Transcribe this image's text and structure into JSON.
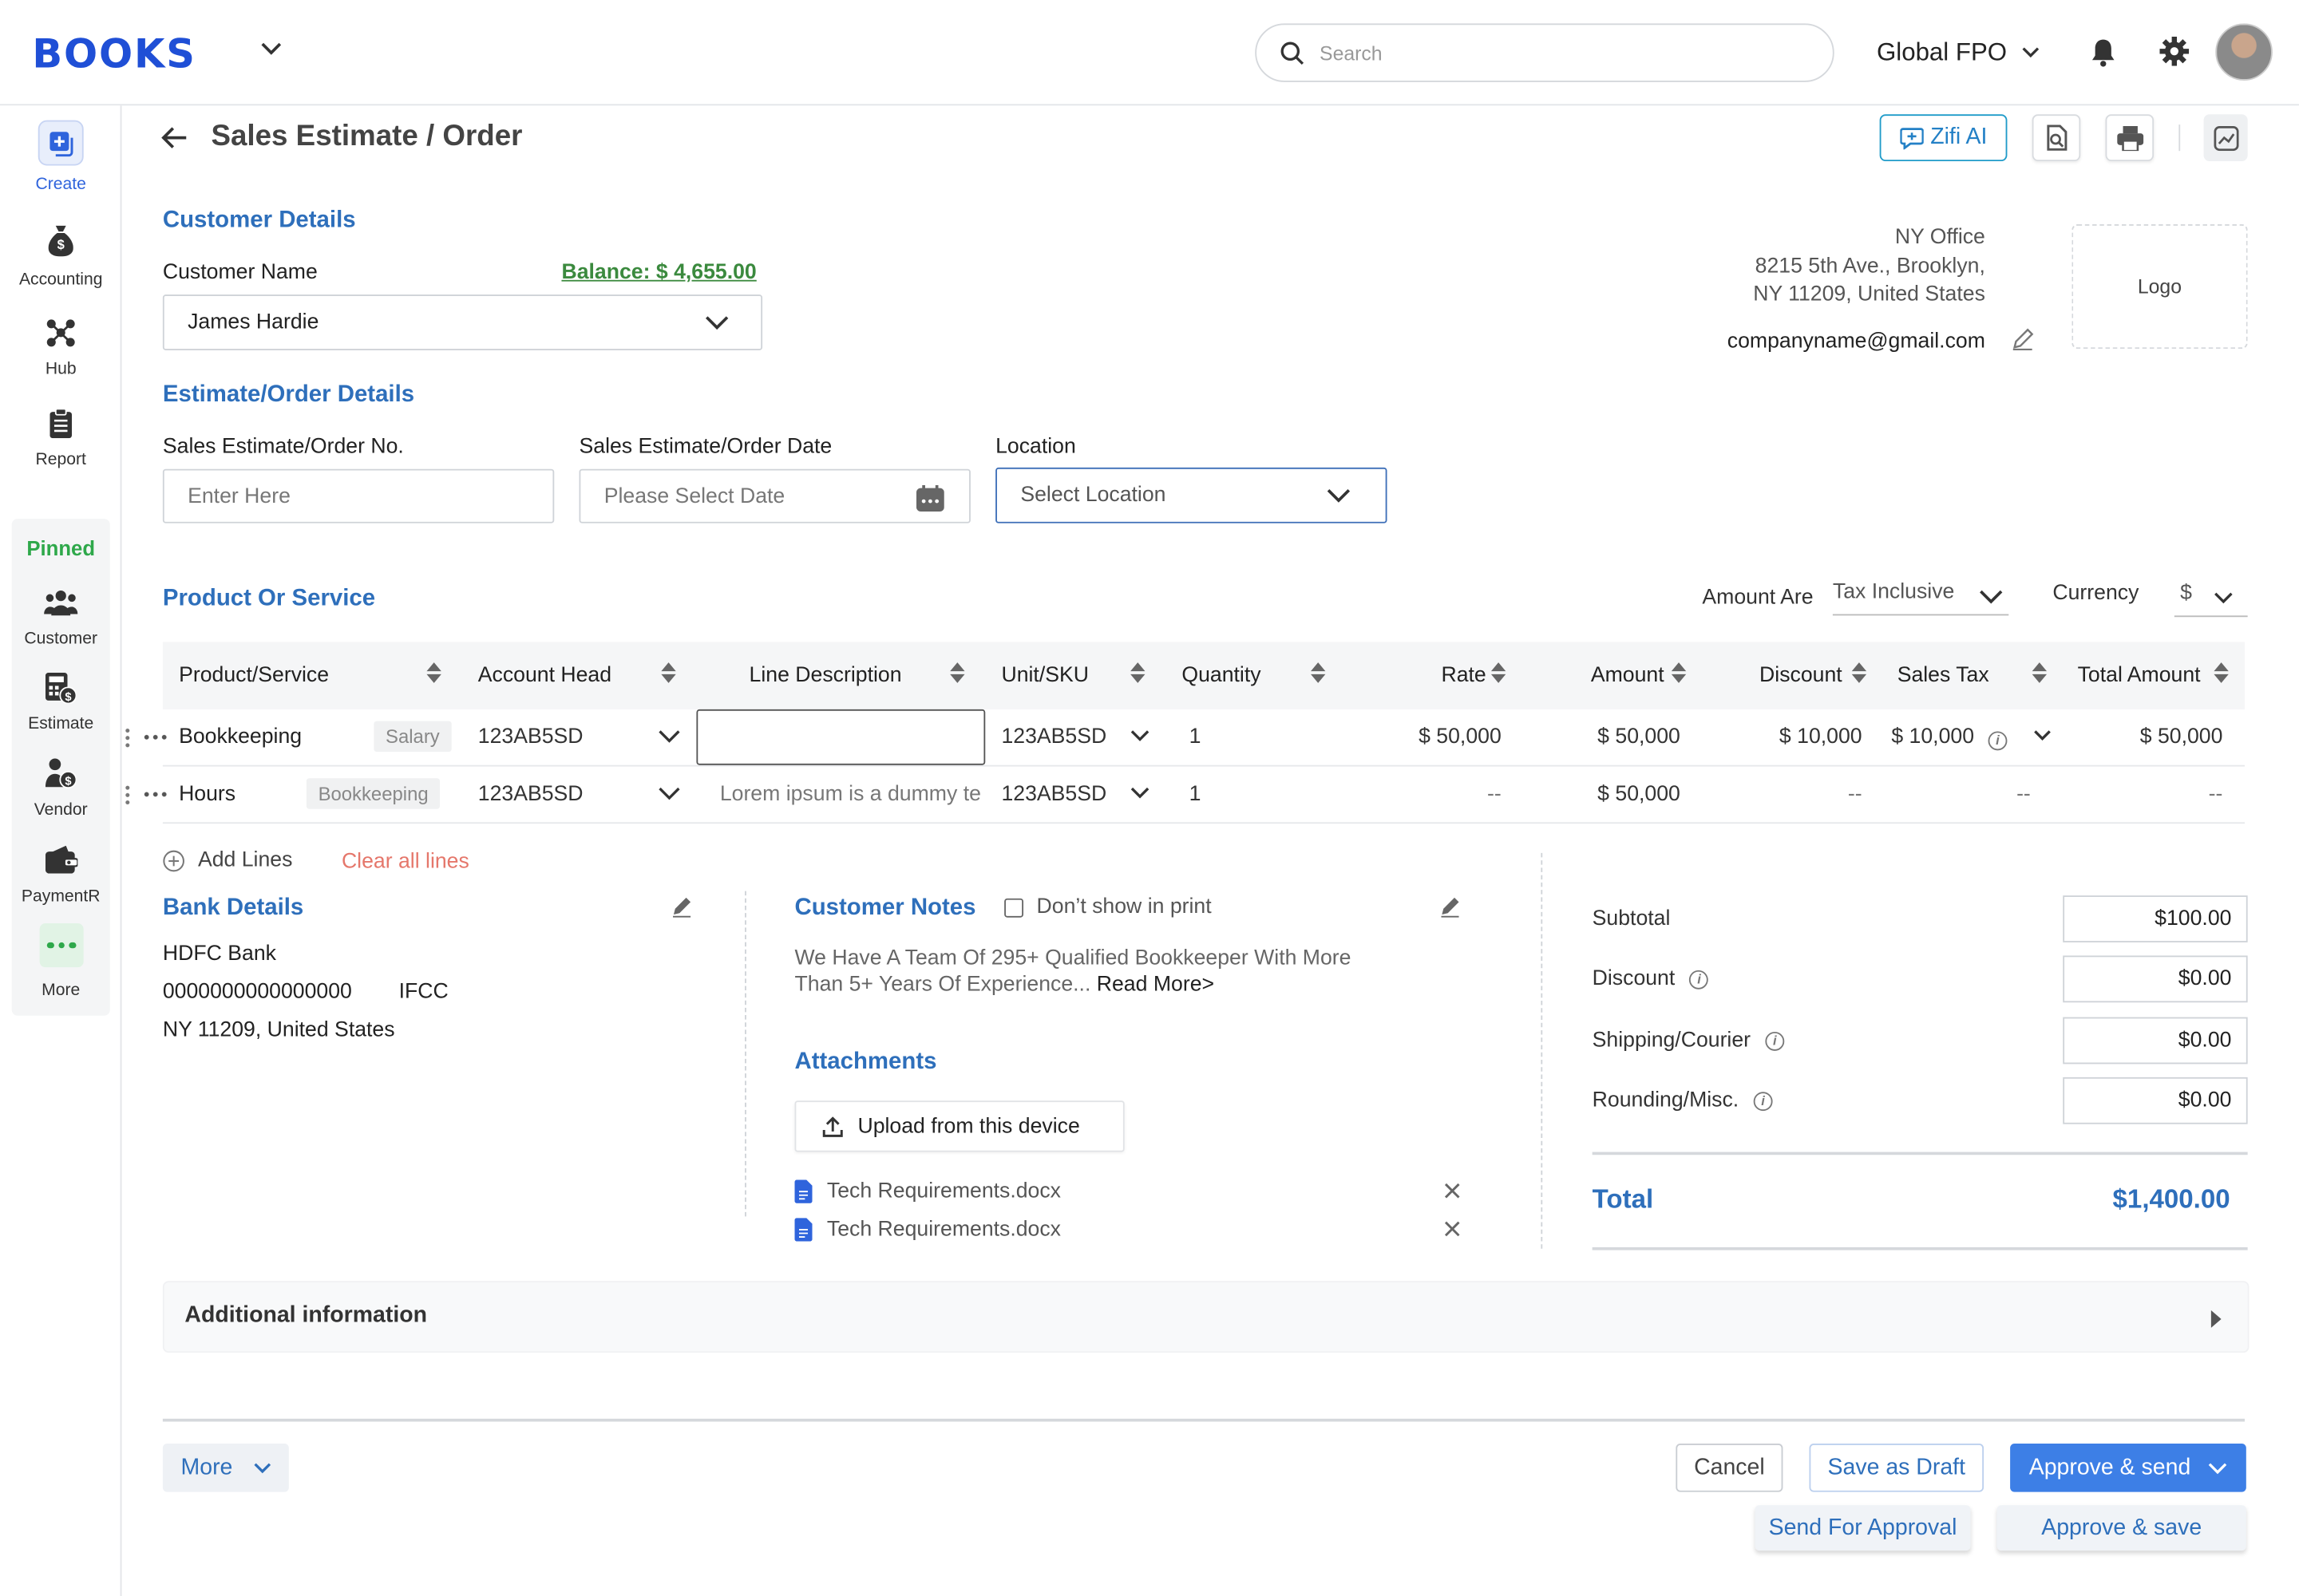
{
  "app": {
    "logo": "BOOKS",
    "company": "Global FPO",
    "search_placeholder": "Search"
  },
  "sidebar": {
    "items": [
      {
        "label": "Create"
      },
      {
        "label": "Accounting"
      },
      {
        "label": "Hub"
      },
      {
        "label": "Report"
      }
    ],
    "pinned_title": "Pinned",
    "pinned": [
      {
        "label": "Customer"
      },
      {
        "label": "Estimate"
      },
      {
        "label": "Vendor"
      },
      {
        "label": "PaymentR"
      },
      {
        "label": "More"
      }
    ]
  },
  "page": {
    "title": "Sales Estimate / Order",
    "zifi_label": "Zifi AI"
  },
  "customer": {
    "section_title": "Customer Details",
    "name_label": "Customer Name",
    "balance": "Balance: $ 4,655.00",
    "name_value": "James Hardie"
  },
  "company": {
    "office": "NY Office",
    "address1": "8215 5th Ave., Brooklyn,",
    "address2": "NY 11209, United States",
    "email": "companyname@gmail.com",
    "logo_label": "Logo"
  },
  "estimate": {
    "section_title": "Estimate/Order Details",
    "no_label": "Sales Estimate/Order No.",
    "no_placeholder": "Enter Here",
    "date_label": "Sales Estimate/Order Date",
    "date_placeholder": "Please Select Date",
    "location_label": "Location",
    "location_placeholder": "Select Location"
  },
  "products": {
    "section_title": "Product Or Service",
    "amount_are_label": "Amount Are",
    "amount_are_value": "Tax Inclusive",
    "currency_label": "Currency",
    "currency_value": "$",
    "columns": [
      "Product/Service",
      "Account Head",
      "Line Description",
      "Unit/SKU",
      "Quantity",
      "Rate",
      "Amount",
      "Discount",
      "Sales Tax",
      "Total Amount"
    ],
    "rows": [
      {
        "product": "Bookkeeping",
        "tag": "Salary",
        "account": "123AB5SD",
        "description": "",
        "unit": "123AB5SD",
        "qty": "1",
        "rate": "$ 50,000",
        "amount": "$ 50,000",
        "discount": "$ 10,000",
        "tax": "$ 10,000",
        "total": "$ 50,000"
      },
      {
        "product": "Hours",
        "tag": "Bookkeeping",
        "account": "123AB5SD",
        "description": "Lorem ipsum is a dummy te",
        "unit": "123AB5SD",
        "qty": "1",
        "rate": "--",
        "amount": "$ 50,000",
        "discount": "--",
        "tax": "--",
        "total": "--"
      }
    ],
    "add_lines": "Add Lines",
    "clear_lines": "Clear all lines"
  },
  "bank": {
    "title": "Bank Details",
    "name": "HDFC Bank",
    "account": "0000000000000000",
    "ifsc": "IFCC",
    "address": "NY 11209, United States"
  },
  "notes": {
    "title": "Customer Notes",
    "dont_show": "Don’t show in print",
    "text1": "We Have A Team Of 295+ Qualified Bookkeeper With More",
    "text2": "Than 5+ Years Of Experience...",
    "read_more": "Read More>"
  },
  "attachments": {
    "title": "Attachments",
    "upload_label": "Upload from this device",
    "files": [
      "Tech Requirements.docx",
      "Tech Requirements.docx"
    ]
  },
  "summary": {
    "subtotal_label": "Subtotal",
    "subtotal": "$100.00",
    "discount_label": "Discount",
    "discount": "$0.00",
    "shipping_label": "Shipping/Courier",
    "shipping": "$0.00",
    "rounding_label": "Rounding/Misc.",
    "rounding": "$0.00",
    "total_label": "Total",
    "total": "$1,400.00"
  },
  "additional": {
    "label": "Additional information"
  },
  "footer": {
    "more": "More",
    "cancel": "Cancel",
    "save_draft": "Save as Draft",
    "approve_send": "Approve & send",
    "send_approval": "Send For Approval",
    "approve_save": "Approve & save"
  },
  "colors": {
    "accent": "#2e6fbb",
    "primary_button": "#3d7fe6",
    "balance_green": "#3b8a3e",
    "clear_red": "#e5776b",
    "pinned_green": "#2ea84a"
  }
}
